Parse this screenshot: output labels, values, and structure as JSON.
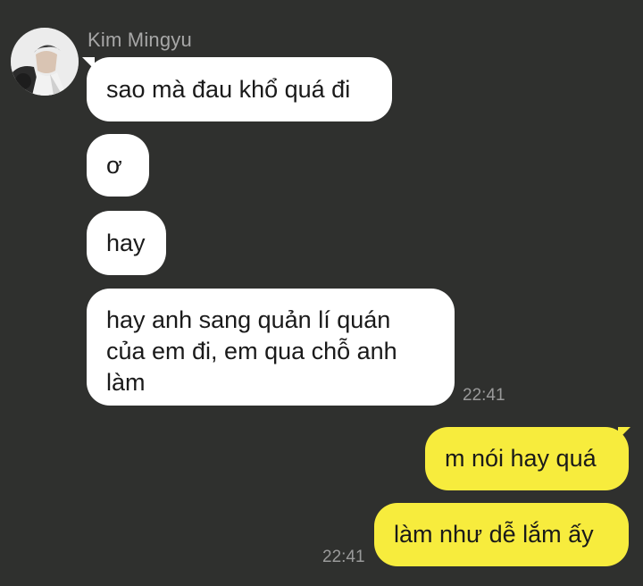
{
  "contact": {
    "name": "Kim Mingyu",
    "avatar_icon": "profile-photo"
  },
  "messages": {
    "incoming": [
      {
        "text": "sao mà đau khổ quá đi"
      },
      {
        "text": "ơ"
      },
      {
        "text": "hay"
      },
      {
        "text": "hay anh sang quản lí quán của em đi, em qua chỗ anh làm"
      }
    ],
    "incoming_time": "22:41",
    "outgoing": [
      {
        "text": "m nói hay quá"
      },
      {
        "text": "làm như dễ lắm ấy"
      }
    ],
    "outgoing_time": "22:41"
  },
  "colors": {
    "background": "#2f302e",
    "incoming_bubble": "#ffffff",
    "outgoing_bubble": "#f7ec3d",
    "meta_text": "#9a9a9a"
  }
}
